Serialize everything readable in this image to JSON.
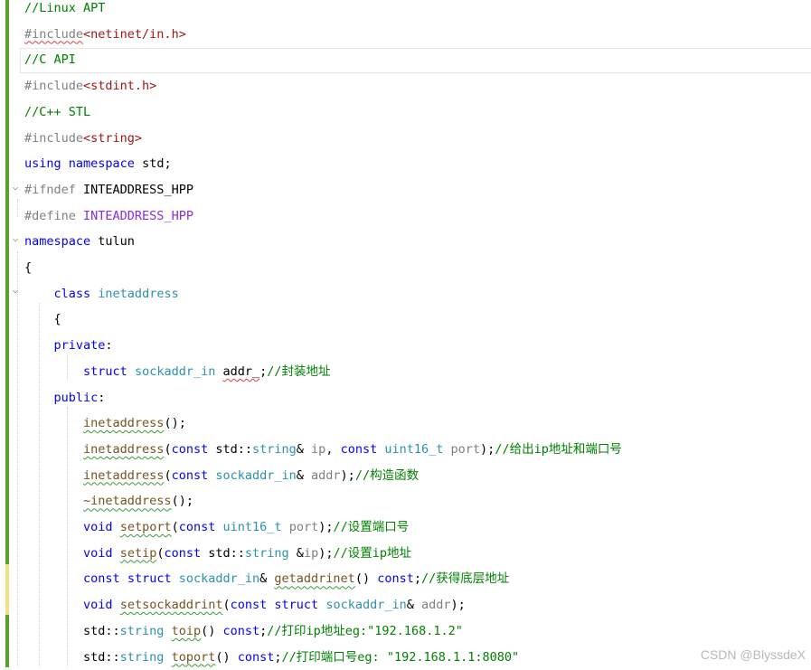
{
  "lines": [
    {
      "tokens": [
        {
          "t": "//Linux APT",
          "c": "cm"
        }
      ]
    },
    {
      "tokens": [
        {
          "t": "#include",
          "c": "pp squig"
        },
        {
          "t": "<netinet/in.h>",
          "c": "inc"
        }
      ]
    },
    {
      "tokens": [
        {
          "t": "//C API",
          "c": "cm"
        }
      ]
    },
    {
      "tokens": [
        {
          "t": "#include",
          "c": "pp"
        },
        {
          "t": "<stdint.h>",
          "c": "inc"
        }
      ]
    },
    {
      "tokens": [
        {
          "t": "//C++ STL",
          "c": "cm"
        }
      ]
    },
    {
      "tokens": [
        {
          "t": "#include",
          "c": "pp"
        },
        {
          "t": "<string>",
          "c": "inc"
        }
      ]
    },
    {
      "tokens": [
        {
          "t": "using",
          "c": "kw"
        },
        {
          "t": " ",
          "c": "pl"
        },
        {
          "t": "namespace",
          "c": "kw"
        },
        {
          "t": " std;",
          "c": "pl"
        }
      ]
    },
    {
      "tokens": [
        {
          "t": "#ifndef",
          "c": "pp"
        },
        {
          "t": " INTEADDRESS_HPP",
          "c": "pl"
        }
      ]
    },
    {
      "tokens": [
        {
          "t": "#define",
          "c": "pp"
        },
        {
          "t": " INTEADDRESS_HPP",
          "c": "mac"
        }
      ]
    },
    {
      "tokens": [
        {
          "t": "namespace",
          "c": "kw"
        },
        {
          "t": " tulun",
          "c": "pl"
        }
      ]
    },
    {
      "tokens": [
        {
          "t": "{",
          "c": "pl"
        }
      ]
    },
    {
      "tokens": [
        {
          "t": "    ",
          "c": "pl"
        },
        {
          "t": "class",
          "c": "kw"
        },
        {
          "t": " ",
          "c": "pl"
        },
        {
          "t": "inetaddress",
          "c": "ty"
        }
      ]
    },
    {
      "tokens": [
        {
          "t": "    {",
          "c": "pl"
        }
      ]
    },
    {
      "tokens": [
        {
          "t": "    ",
          "c": "pl"
        },
        {
          "t": "private",
          "c": "kw"
        },
        {
          "t": ":",
          "c": "pl"
        }
      ]
    },
    {
      "tokens": [
        {
          "t": "        ",
          "c": "pl"
        },
        {
          "t": "struct",
          "c": "kw"
        },
        {
          "t": " ",
          "c": "pl"
        },
        {
          "t": "sockaddr_in",
          "c": "ty"
        },
        {
          "t": " ",
          "c": "pl"
        },
        {
          "t": "addr_",
          "c": "pl squig"
        },
        {
          "t": ";",
          "c": "pl"
        },
        {
          "t": "//封装地址",
          "c": "cm"
        }
      ]
    },
    {
      "tokens": [
        {
          "t": "    ",
          "c": "pl"
        },
        {
          "t": "public",
          "c": "kw"
        },
        {
          "t": ":",
          "c": "pl"
        }
      ]
    },
    {
      "tokens": [
        {
          "t": "        ",
          "c": "pl"
        },
        {
          "t": "inetaddress",
          "c": "fn squig-g"
        },
        {
          "t": "();",
          "c": "pl"
        }
      ]
    },
    {
      "tokens": [
        {
          "t": "        ",
          "c": "pl"
        },
        {
          "t": "inetaddress",
          "c": "fn squig-g"
        },
        {
          "t": "(",
          "c": "pl"
        },
        {
          "t": "const",
          "c": "kw"
        },
        {
          "t": " std::",
          "c": "pl"
        },
        {
          "t": "string",
          "c": "ty"
        },
        {
          "t": "& ",
          "c": "pl"
        },
        {
          "t": "ip",
          "c": "param"
        },
        {
          "t": ", ",
          "c": "pl"
        },
        {
          "t": "const",
          "c": "kw"
        },
        {
          "t": " ",
          "c": "pl"
        },
        {
          "t": "uint16_t",
          "c": "ty"
        },
        {
          "t": " ",
          "c": "pl"
        },
        {
          "t": "port",
          "c": "param"
        },
        {
          "t": ");",
          "c": "pl"
        },
        {
          "t": "//给出ip地址和端口号",
          "c": "cm"
        }
      ]
    },
    {
      "tokens": [
        {
          "t": "        ",
          "c": "pl"
        },
        {
          "t": "inetaddress",
          "c": "fn squig-g"
        },
        {
          "t": "(",
          "c": "pl"
        },
        {
          "t": "const",
          "c": "kw"
        },
        {
          "t": " ",
          "c": "pl"
        },
        {
          "t": "sockaddr_in",
          "c": "ty"
        },
        {
          "t": "& ",
          "c": "pl"
        },
        {
          "t": "addr",
          "c": "param"
        },
        {
          "t": ");",
          "c": "pl"
        },
        {
          "t": "//构造函数",
          "c": "cm"
        }
      ]
    },
    {
      "tokens": [
        {
          "t": "        ",
          "c": "pl"
        },
        {
          "t": "~inetaddress",
          "c": "fn squig-g"
        },
        {
          "t": "();",
          "c": "pl"
        }
      ]
    },
    {
      "tokens": [
        {
          "t": "        ",
          "c": "pl"
        },
        {
          "t": "void",
          "c": "kw"
        },
        {
          "t": " ",
          "c": "pl"
        },
        {
          "t": "setport",
          "c": "fn squig-g"
        },
        {
          "t": "(",
          "c": "pl"
        },
        {
          "t": "const",
          "c": "kw"
        },
        {
          "t": " ",
          "c": "pl"
        },
        {
          "t": "uint16_t",
          "c": "ty"
        },
        {
          "t": " ",
          "c": "pl"
        },
        {
          "t": "port",
          "c": "param"
        },
        {
          "t": ");",
          "c": "pl"
        },
        {
          "t": "//设置端口号",
          "c": "cm"
        }
      ]
    },
    {
      "tokens": [
        {
          "t": "        ",
          "c": "pl"
        },
        {
          "t": "void",
          "c": "kw"
        },
        {
          "t": " ",
          "c": "pl"
        },
        {
          "t": "setip",
          "c": "fn squig-g"
        },
        {
          "t": "(",
          "c": "pl"
        },
        {
          "t": "const",
          "c": "kw"
        },
        {
          "t": " std::",
          "c": "pl"
        },
        {
          "t": "string",
          "c": "ty"
        },
        {
          "t": " &",
          "c": "pl"
        },
        {
          "t": "ip",
          "c": "param"
        },
        {
          "t": ");",
          "c": "pl"
        },
        {
          "t": "//设置ip地址",
          "c": "cm"
        }
      ]
    },
    {
      "tokens": [
        {
          "t": "        ",
          "c": "pl"
        },
        {
          "t": "const",
          "c": "kw"
        },
        {
          "t": " ",
          "c": "pl"
        },
        {
          "t": "struct",
          "c": "kw"
        },
        {
          "t": " ",
          "c": "pl"
        },
        {
          "t": "sockaddr_in",
          "c": "ty"
        },
        {
          "t": "& ",
          "c": "pl"
        },
        {
          "t": "getaddrinet",
          "c": "fn squig-g"
        },
        {
          "t": "() ",
          "c": "pl"
        },
        {
          "t": "const",
          "c": "kw"
        },
        {
          "t": ";",
          "c": "pl"
        },
        {
          "t": "//获得底层地址",
          "c": "cm"
        }
      ]
    },
    {
      "tokens": [
        {
          "t": "        ",
          "c": "pl"
        },
        {
          "t": "void",
          "c": "kw"
        },
        {
          "t": " ",
          "c": "pl"
        },
        {
          "t": "setsockaddrint",
          "c": "fn squig-g"
        },
        {
          "t": "(",
          "c": "pl"
        },
        {
          "t": "const",
          "c": "kw"
        },
        {
          "t": " ",
          "c": "pl"
        },
        {
          "t": "struct",
          "c": "kw"
        },
        {
          "t": " ",
          "c": "pl"
        },
        {
          "t": "sockaddr_in",
          "c": "ty"
        },
        {
          "t": "& ",
          "c": "pl"
        },
        {
          "t": "addr",
          "c": "param"
        },
        {
          "t": ");",
          "c": "pl"
        }
      ]
    },
    {
      "tokens": [
        {
          "t": "        std::",
          "c": "pl"
        },
        {
          "t": "string",
          "c": "ty"
        },
        {
          "t": " ",
          "c": "pl"
        },
        {
          "t": "toip",
          "c": "fn squig-g"
        },
        {
          "t": "() ",
          "c": "pl"
        },
        {
          "t": "const",
          "c": "kw"
        },
        {
          "t": ";",
          "c": "pl"
        },
        {
          "t": "//打印ip地址eg:\"192.168.1.2\"",
          "c": "cm"
        }
      ]
    },
    {
      "tokens": [
        {
          "t": "        std::",
          "c": "pl"
        },
        {
          "t": "string",
          "c": "ty"
        },
        {
          "t": " ",
          "c": "pl"
        },
        {
          "t": "toport",
          "c": "fn squig-g"
        },
        {
          "t": "() ",
          "c": "pl"
        },
        {
          "t": "const",
          "c": "kw"
        },
        {
          "t": ";",
          "c": "pl"
        },
        {
          "t": "//打印端口号eg: \"192.168.1.1:8080\"",
          "c": "cm"
        }
      ]
    }
  ],
  "watermark": "CSDN @BlyssdeX",
  "icons": {
    "fold": "fold-collapse-icon"
  }
}
